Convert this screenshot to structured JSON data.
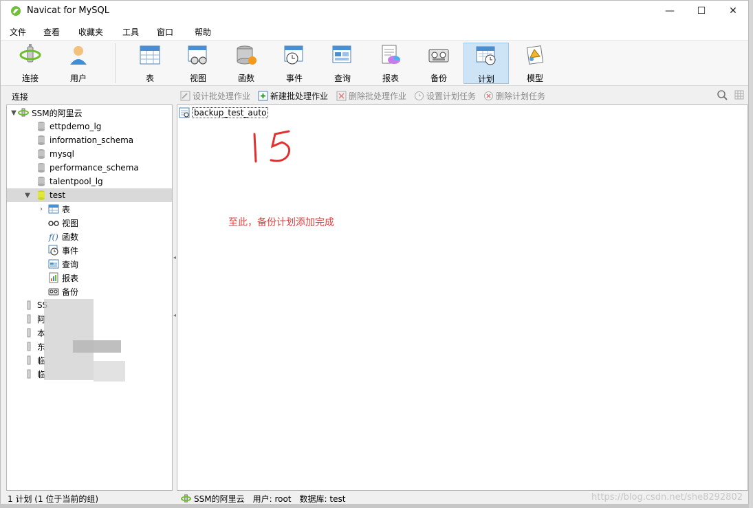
{
  "window": {
    "title": "Navicat for MySQL",
    "controls": {
      "minimize": "—",
      "maximize": "☐",
      "close": "✕"
    }
  },
  "menu": [
    "文件",
    "查看",
    "收藏夹",
    "工具",
    "窗口",
    "帮助"
  ],
  "toolbar": [
    {
      "label": "连接",
      "icon": "connection-icon"
    },
    {
      "label": "用户",
      "icon": "user-icon"
    },
    {
      "label": "表",
      "icon": "table-icon"
    },
    {
      "label": "视图",
      "icon": "view-icon"
    },
    {
      "label": "函数",
      "icon": "function-icon"
    },
    {
      "label": "事件",
      "icon": "event-icon"
    },
    {
      "label": "查询",
      "icon": "query-icon"
    },
    {
      "label": "报表",
      "icon": "report-icon"
    },
    {
      "label": "备份",
      "icon": "backup-icon"
    },
    {
      "label": "计划",
      "icon": "schedule-icon",
      "active": true
    },
    {
      "label": "模型",
      "icon": "model-icon"
    }
  ],
  "subbar": {
    "connection_label": "连接",
    "actions": [
      {
        "label": "设计批处理作业",
        "enabled": false
      },
      {
        "label": "新建批处理作业",
        "enabled": true
      },
      {
        "label": "删除批处理作业",
        "enabled": false
      },
      {
        "label": "设置计划任务",
        "enabled": false
      },
      {
        "label": "删除计划任务",
        "enabled": false
      }
    ]
  },
  "tree": {
    "connection": "SSM的阿里云",
    "databases": [
      "ettpdemo_lg",
      "information_schema",
      "mysql",
      "performance_schema",
      "talentpool_lg",
      "test"
    ],
    "selected_db": "test",
    "db_children": [
      "表",
      "视图",
      "函数",
      "事件",
      "查询",
      "报表",
      "备份"
    ],
    "other_connections": [
      "SS",
      "阿",
      "本",
      "东",
      "临",
      "临"
    ]
  },
  "content": {
    "job_name": "backup_test_auto",
    "handwriting": "15",
    "note": "至此，备份计划添加完成"
  },
  "status": {
    "left": "1 计划 (1 位于当前的组)",
    "connection": "SSM的阿里云",
    "user": "用户: root",
    "database": "数据库: test",
    "watermark": "https://blog.csdn.net/she8292802"
  },
  "colors": {
    "accent": "#cde4f7",
    "note": "#e04040"
  }
}
